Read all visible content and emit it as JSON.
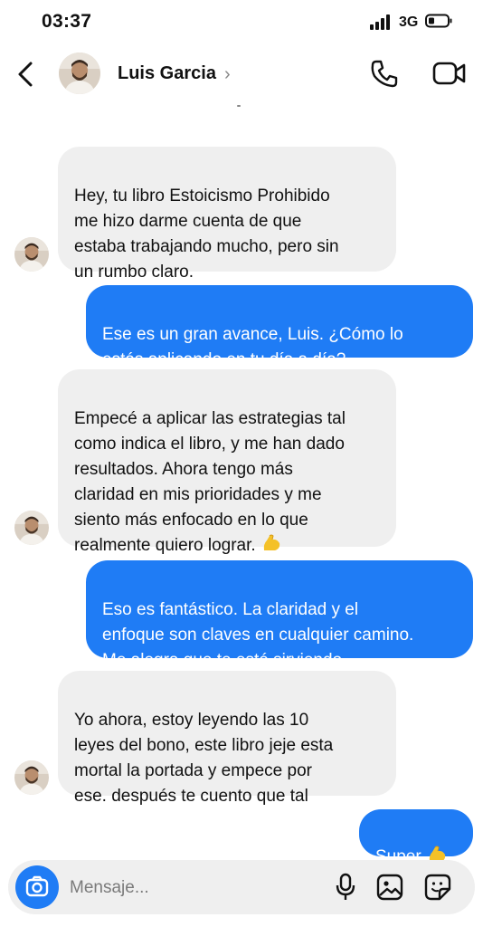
{
  "status_bar": {
    "time": "03:37",
    "network": "3G",
    "signal_icon": "signal-bars-icon",
    "battery_icon": "battery-low-icon",
    "battery_level": 0.2
  },
  "header": {
    "contact_name": "Luis Garcia",
    "chevron": "›",
    "back_icon": "chevron-left-icon",
    "call_icon": "phone-icon",
    "video_icon": "video-camera-icon"
  },
  "messages": [
    {
      "direction": "incoming",
      "text": "Hey, tu libro Estoicismo Prohibido\nme hizo darme cuenta de que\nestaba trabajando mucho, pero sin\nun rumbo claro."
    },
    {
      "direction": "outgoing",
      "text": "Ese es un gran avance, Luis. ¿Cómo lo\nestás aplicando en tu día a día?"
    },
    {
      "direction": "incoming",
      "text": "Empecé a aplicar las estrategias tal\ncomo indica el libro, y me han dado\nresultados. Ahora tengo más\nclaridad en mis prioridades y me\nsiento más enfocado en lo que\nrealmente quiero lograr.",
      "emoji": "flexed-biceps-icon"
    },
    {
      "direction": "outgoing",
      "text": "Eso es fantástico. La claridad y el\nenfoque son claves en cualquier camino.\nMe alegra que te esté sirviendo."
    },
    {
      "direction": "incoming",
      "text": "Yo ahora, estoy leyendo las 10\nleyes del bono, este libro jeje esta\nmortal la portada y empece por\nese. después te cuento que tal"
    },
    {
      "direction": "outgoing",
      "text": "Super",
      "emoji": "flexed-biceps-icon"
    }
  ],
  "composer": {
    "placeholder": "Mensaje...",
    "camera_icon": "camera-icon",
    "mic_icon": "microphone-icon",
    "gallery_icon": "image-icon",
    "sticker_icon": "sticker-icon"
  },
  "colors": {
    "outgoing_bubble": "#1f7cf5",
    "incoming_bubble": "#efefef",
    "camera_button": "#1f7cf5",
    "emoji_yellow": "#f4c128"
  }
}
